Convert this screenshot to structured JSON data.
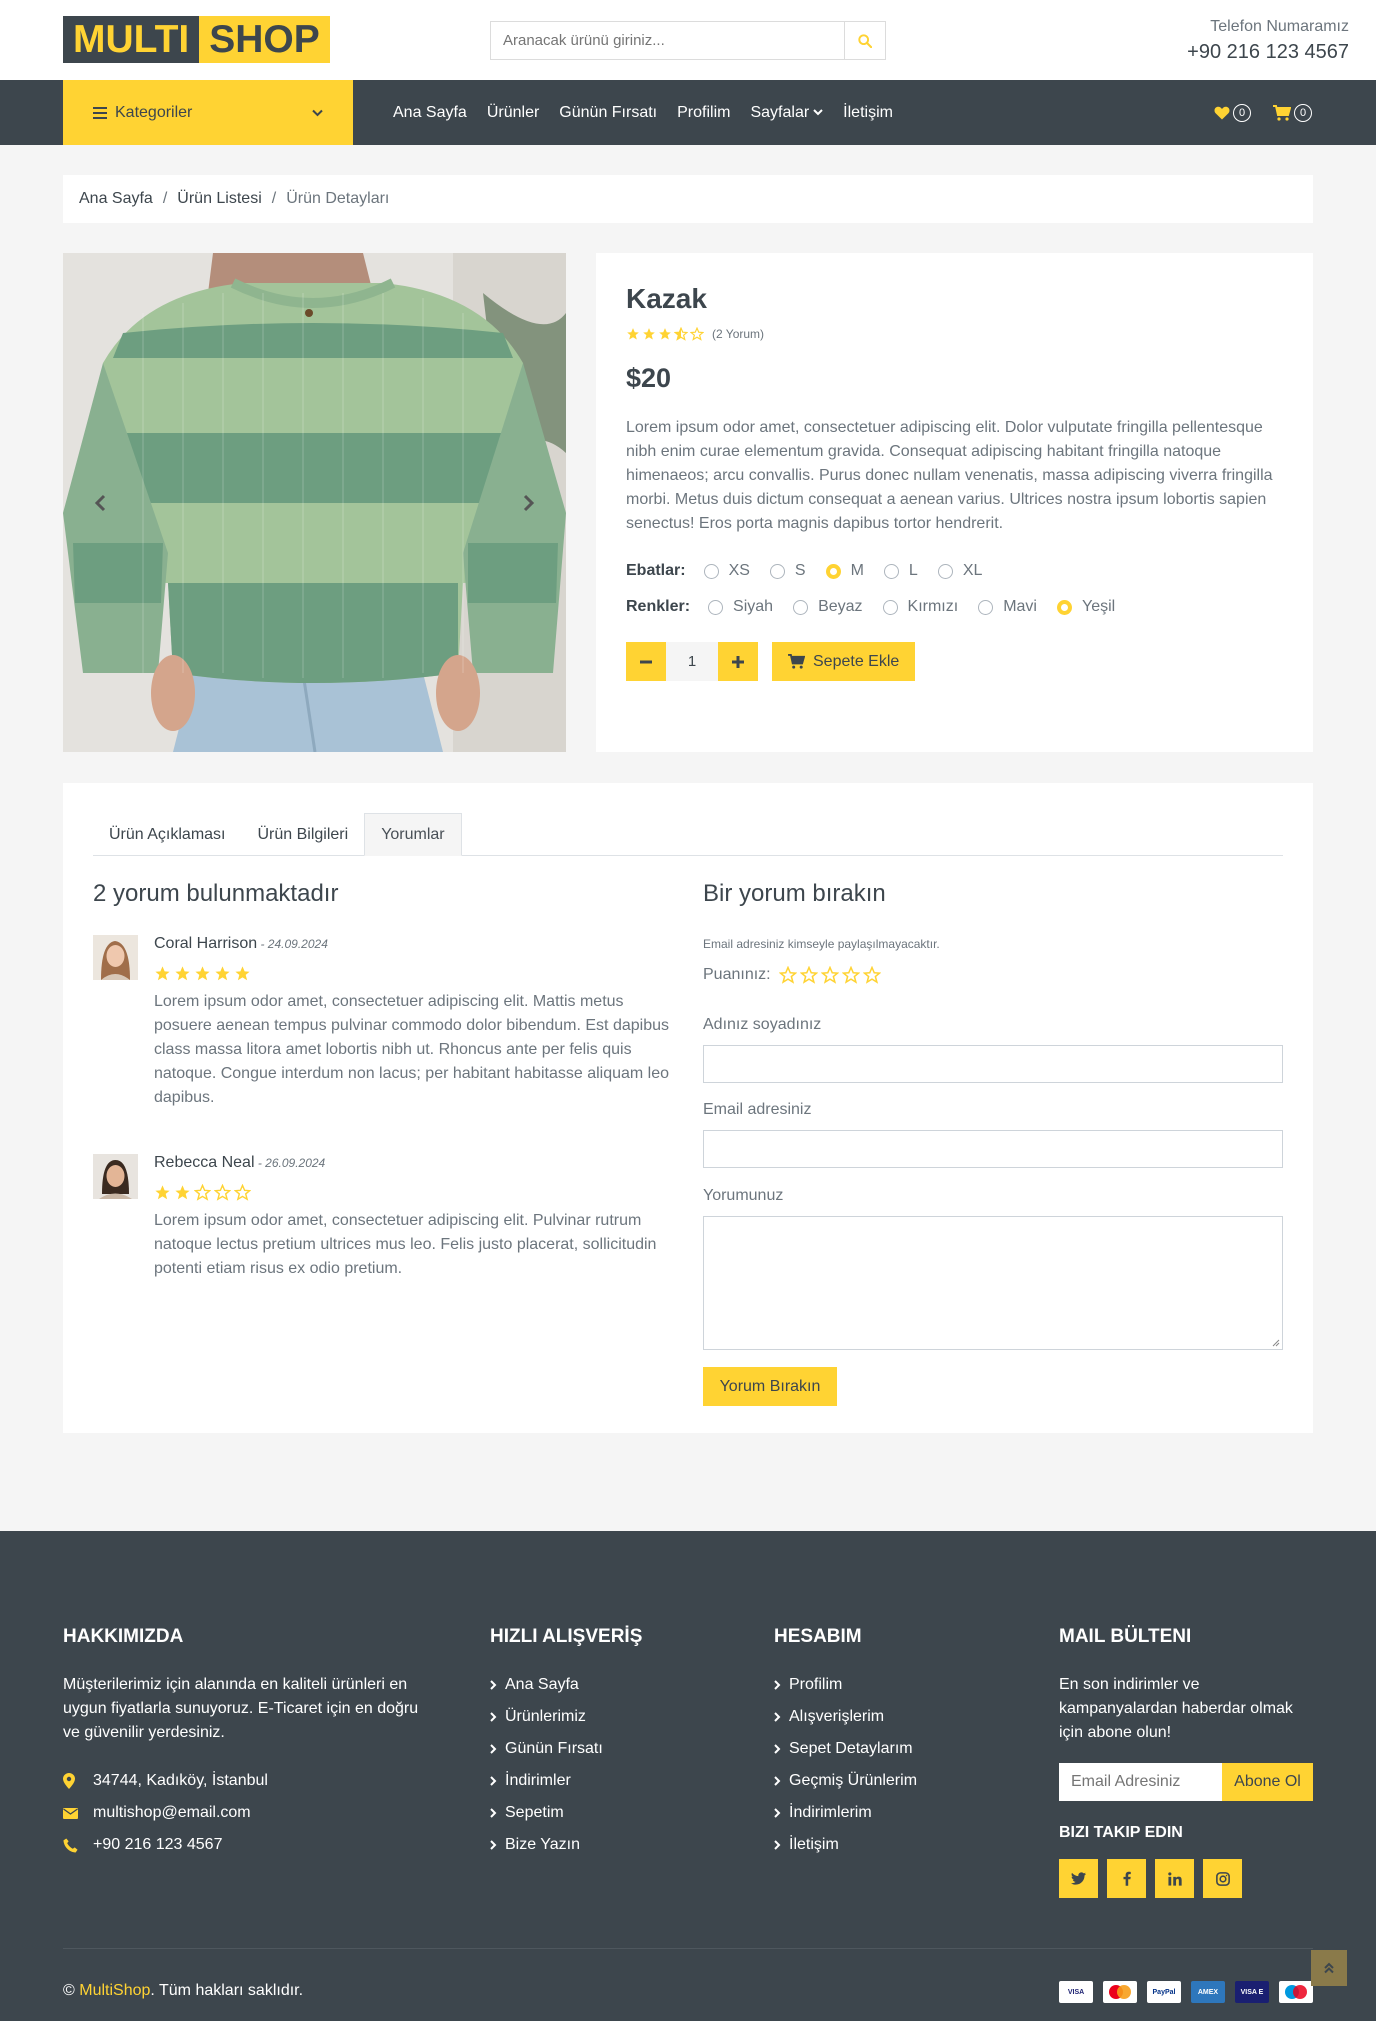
{
  "header": {
    "logo_part1": "MULTI",
    "logo_part2": "SHOP",
    "search_placeholder": "Aranacak ürünü giriniz...",
    "phone_label": "Telefon Numaramız",
    "phone_number": "+90 216 123 4567"
  },
  "nav": {
    "categories_label": "Kategoriler",
    "links": [
      "Ana Sayfa",
      "Ürünler",
      "Günün Fırsatı",
      "Profilim",
      "Sayfalar",
      "İletişim"
    ],
    "wishlist_count": "0",
    "cart_count": "0"
  },
  "breadcrumb": [
    "Ana Sayfa",
    "Ürün Listesi",
    "Ürün Detayları"
  ],
  "product": {
    "title": "Kazak",
    "rating": 3.5,
    "review_count": "(2 Yorum)",
    "price": "$20",
    "description": "Lorem ipsum odor amet, consectetuer adipiscing elit. Dolor vulputate fringilla pellentesque nibh enim curae elementum gravida. Consequat adipiscing habitant fringilla natoque himenaeos; arcu convallis. Purus donec nullam venenatis, massa adipiscing viverra fringilla morbi. Metus duis dictum consequat a aenean varius. Ultrices nostra ipsum lobortis sapien senectus! Eros porta magnis dapibus tortor hendrerit.",
    "sizes_label": "Ebatlar:",
    "sizes": [
      "XS",
      "S",
      "M",
      "L",
      "XL"
    ],
    "selected_size": "M",
    "colors_label": "Renkler:",
    "colors": [
      "Siyah",
      "Beyaz",
      "Kırmızı",
      "Mavi",
      "Yeşil"
    ],
    "selected_color": "Yeşil",
    "quantity": "1",
    "add_to_cart": "Sepete Ekle"
  },
  "tabs": [
    "Ürün Açıklaması",
    "Ürün Bilgileri",
    "Yorumlar"
  ],
  "active_tab": "Yorumlar",
  "reviews": {
    "heading": "2 yorum bulunmaktadır",
    "items": [
      {
        "name": "Coral Harrison",
        "date": " - 24.09.2024",
        "rating": 5,
        "text": "Lorem ipsum odor amet, consectetuer adipiscing elit. Mattis metus posuere aenean tempus pulvinar commodo dolor bibendum. Est dapibus class massa litora amet lobortis nibh ut. Rhoncus ante per felis quis natoque. Congue interdum non lacus; per habitant habitasse aliquam leo dapibus."
      },
      {
        "name": "Rebecca Neal",
        "date": " - 26.09.2024",
        "rating": 2,
        "text": "Lorem ipsum odor amet, consectetuer adipiscing elit. Pulvinar rutrum natoque lectus pretium ultrices mus leo. Felis justo placerat, sollicitudin potenti etiam risus ex odio pretium."
      }
    ]
  },
  "review_form": {
    "heading": "Bir yorum bırakın",
    "note": "Email adresiniz kimseyle paylaşılmayacaktır.",
    "rating_label": "Puanınız:",
    "name_label": "Adınız soyadınız",
    "email_label": "Email adresiniz",
    "comment_label": "Yorumunuz",
    "submit_label": "Yorum Bırakın"
  },
  "footer": {
    "about_heading": "HAKKIMIZDA",
    "about_text": "Müşterilerimiz için alanında en kaliteli ürünleri en uygun fiyatlarla sunuyoruz. E-Ticaret için en doğru ve güvenilir yerdesiniz.",
    "address": "34744, Kadıköy, İstanbul",
    "email": "multishop@email.com",
    "phone": "+90 216 123 4567",
    "quick_heading": "HIZLI ALIŞVERİŞ",
    "quick_links": [
      "Ana Sayfa",
      "Ürünlerimiz",
      "Günün Fırsatı",
      "İndirimler",
      "Sepetim",
      "Bize Yazın"
    ],
    "account_heading": "HESABIM",
    "account_links": [
      "Profilim",
      "Alışverişlerim",
      "Sepet Detaylarım",
      "Geçmiş Ürünlerim",
      "İndirimlerim",
      "İletişim"
    ],
    "newsletter_heading": "MAIL BÜLTENI",
    "newsletter_text": "En son indirimler ve kampanyalardan haberdar olmak için abone olun!",
    "newsletter_placeholder": "Email Adresiniz",
    "newsletter_button": "Abone Ol",
    "follow_heading": "BIZI TAKIP EDIN",
    "copyright_brand": "MultiShop",
    "copyright_rest": ". Tüm hakları saklıdır.",
    "copyright_symbol": "©",
    "payment_cards": [
      "VISA",
      "MC",
      "PayPal",
      "AMEX",
      "VISA E",
      "Maestro"
    ]
  },
  "colors": {
    "primary": "#FFD333",
    "dark": "#3D464D",
    "light_bg": "#F5F5F5",
    "text": "#6C757D"
  }
}
